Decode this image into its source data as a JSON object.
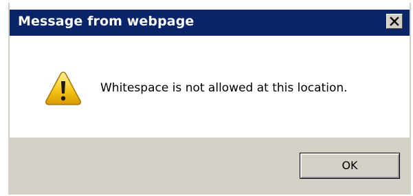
{
  "dialog": {
    "title": "Message from webpage",
    "message": "Whitespace is not allowed at this location.",
    "icon": "warning-icon",
    "close_icon": "close-icon",
    "ok_label": "OK"
  },
  "colors": {
    "titlebar": "#0a246a",
    "title_text": "#ffffff",
    "footer": "#d4d0c8",
    "warning_yellow": "#f5c518"
  }
}
